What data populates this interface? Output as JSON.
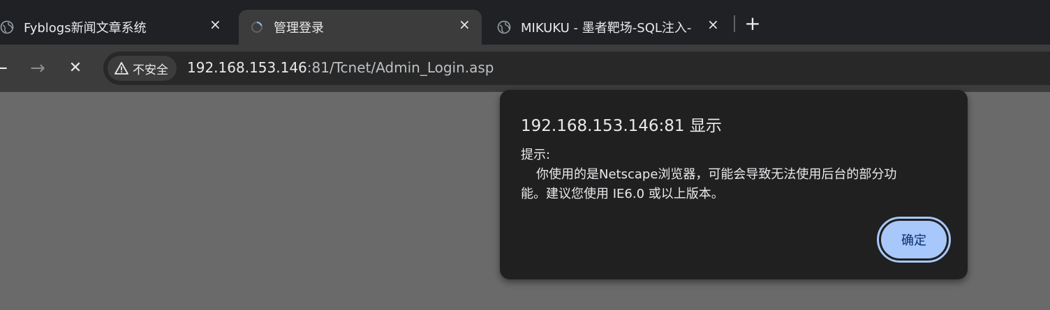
{
  "tabs": [
    {
      "title": "Fyblogs新闻文章系统",
      "close_icon": "×",
      "icon": "globe-icon",
      "active": false
    },
    {
      "title": "管理登录",
      "close_icon": "×",
      "icon": "loading-icon",
      "active": true
    },
    {
      "title": "MIKUKU - 墨者靶场-SQL注入-",
      "close_icon": "×",
      "icon": "globe-icon",
      "active": false
    }
  ],
  "new_tab_symbol": "+",
  "toolbar": {
    "back_symbol": "←",
    "forward_symbol": "→",
    "stop_symbol": "✕",
    "security_label": "不安全",
    "url_host": "192.168.153.146",
    "url_rest": ":81/Tcnet/Admin_Login.asp"
  },
  "dialog": {
    "title": "192.168.153.146:81 显示",
    "message_line1": "提示:",
    "message_line2": "你使用的是Netscape浏览器，可能会导致无法使用后台的部分功",
    "message_line3": "能。建议您使用 IE6.0 或以上版本。",
    "ok_label": "确定"
  },
  "colors": {
    "tabstrip": "#202124",
    "toolbar": "#3c3c3c",
    "page_bg": "#6a6a6a",
    "dialog_bg": "#202020",
    "ok_button": "#a8c7fa"
  }
}
